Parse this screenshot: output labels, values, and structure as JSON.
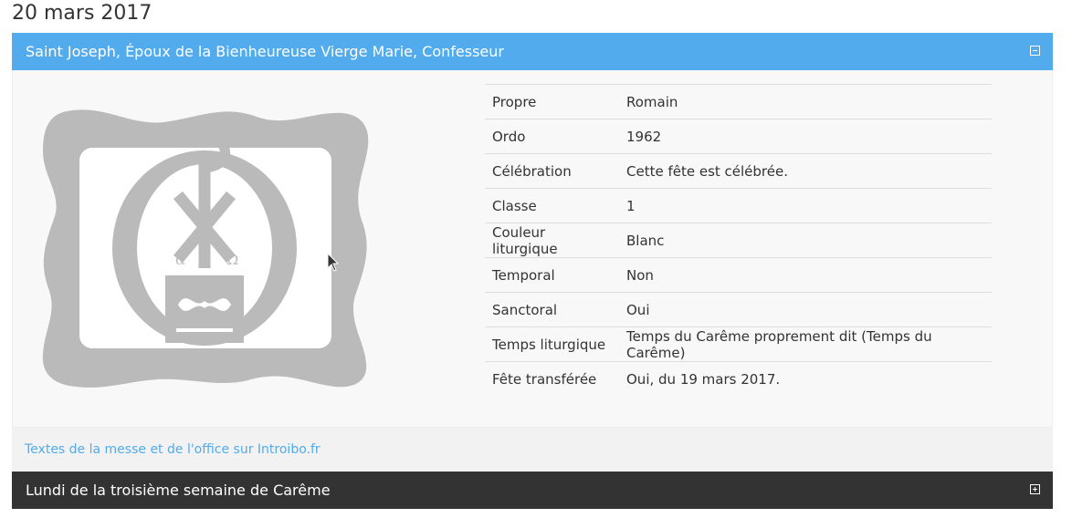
{
  "date": "20 mars 2017",
  "celebrations": [
    {
      "title": "Saint Joseph, Époux de la Bienheureuse Vierge Marie, Confesseur",
      "expanded": true,
      "header_color": "#52abed",
      "logo_icon": "chi-rho-omega-frame-icon",
      "details": [
        {
          "label": "Propre",
          "value": "Romain"
        },
        {
          "label": "Ordo",
          "value": "1962"
        },
        {
          "label": "Célébration",
          "value": "Cette fête est célébrée."
        },
        {
          "label": "Classe",
          "value": "1"
        },
        {
          "label": "Couleur liturgique",
          "value": "Blanc"
        },
        {
          "label": "Temporal",
          "value": "Non"
        },
        {
          "label": "Sanctoral",
          "value": "Oui"
        },
        {
          "label": "Temps liturgique",
          "value": "Temps du Carême proprement dit (Temps du Carême)"
        },
        {
          "label": "Fête transférée",
          "value": "Oui, du 19 mars 2017."
        }
      ],
      "link_text": "Textes de la messe et de l'office sur Introibo.fr"
    },
    {
      "title": "Lundi de la troisième semaine de Carême",
      "expanded": false,
      "header_color": "#333333"
    }
  ]
}
